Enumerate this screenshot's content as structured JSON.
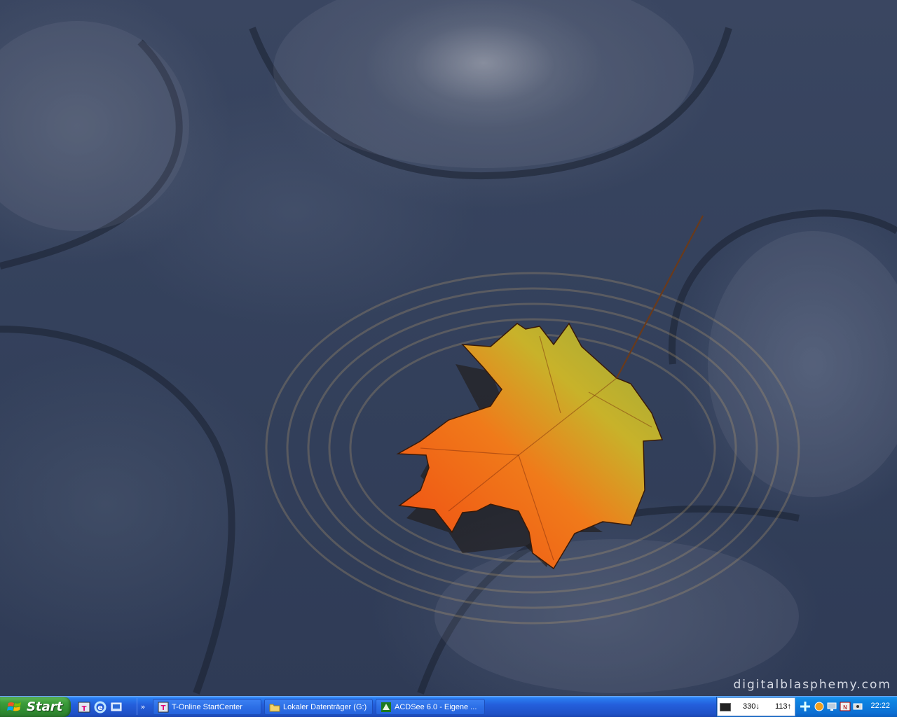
{
  "desktop": {
    "watermark": "digitalblasphemy.com"
  },
  "taskbar": {
    "start_label": "Start",
    "quicklaunch": [
      {
        "icon": "t-online-icon"
      },
      {
        "icon": "internet-explorer-icon"
      },
      {
        "icon": "show-desktop-icon"
      }
    ],
    "more_label": "»",
    "tasks": [
      {
        "label": "T-Online StartCenter",
        "icon": "t-online-icon"
      },
      {
        "label": "Lokaler Datenträger (G:)",
        "icon": "folder-icon"
      },
      {
        "label": "ACDSee 6.0 - Eigene ...",
        "icon": "acdsee-icon"
      }
    ],
    "tray": {
      "meter_down": "330↓",
      "meter_up": "113↑",
      "icons": [
        "network-icon",
        "security-icon",
        "monitor-icon",
        "antivirus-icon",
        "connection-icon"
      ],
      "clock": "22:22"
    }
  },
  "colors": {
    "taskbar_blue": "#245edb",
    "start_green": "#3c9c3b",
    "tray_blue": "#0f85e3",
    "wallpaper_base": "#34415c"
  }
}
